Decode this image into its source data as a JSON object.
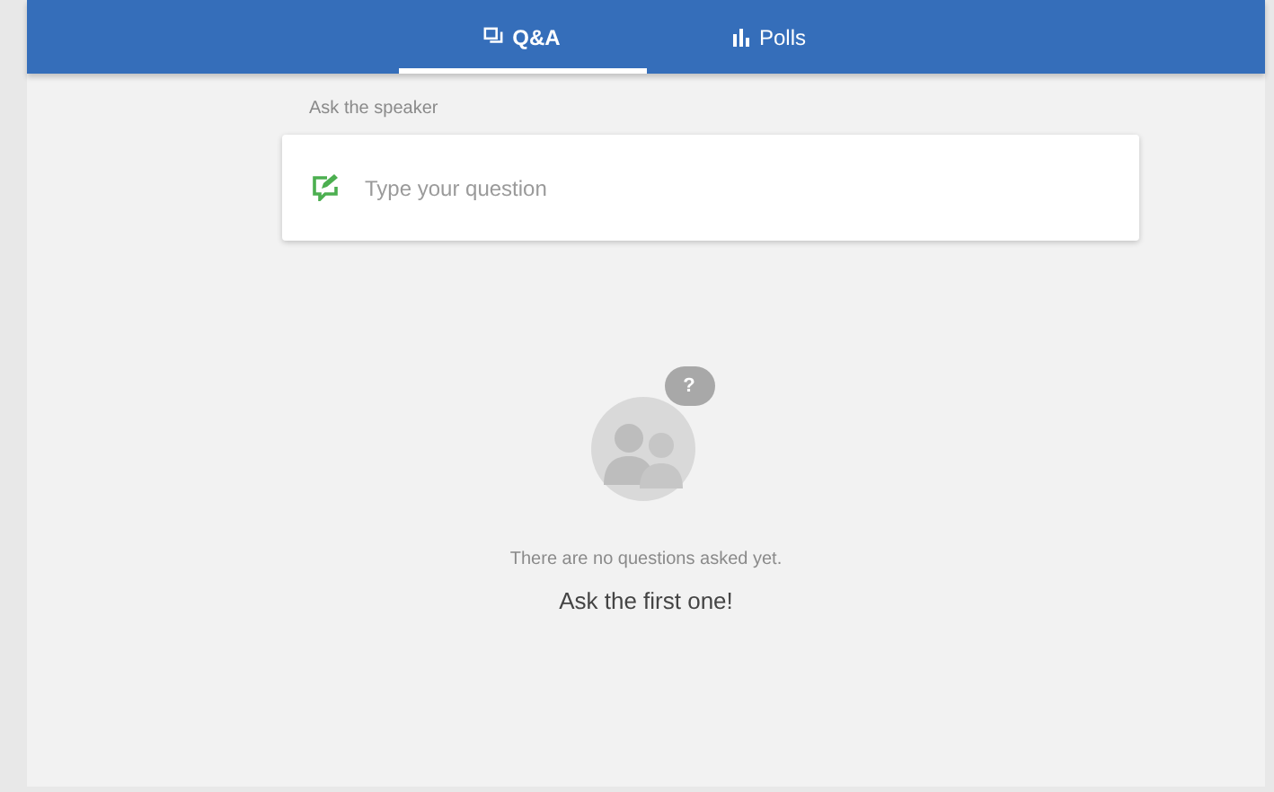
{
  "tabs": [
    {
      "label": "Q&A",
      "kind": "chat",
      "selected": true
    },
    {
      "label": "Polls",
      "kind": "bars",
      "selected": false
    }
  ],
  "section_label": "Ask the speaker",
  "question_field": {
    "placeholder": "Type your question"
  },
  "empty_state": {
    "bubble_mark": "?",
    "message": "There are no questions asked yet.",
    "call_to_action": "Ask the first one!"
  }
}
